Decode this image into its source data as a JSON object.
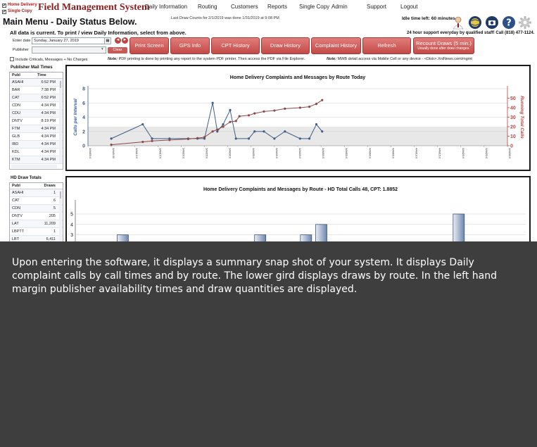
{
  "app": {
    "modes": [
      {
        "label": "Home Delivery",
        "checked": true
      },
      {
        "label": "Single Copy",
        "checked": true
      }
    ],
    "brand": "Field Management System",
    "menu": [
      "Daily Information",
      "Routing",
      "Customers",
      "Reports",
      "Single Copy",
      "Admin",
      "Support",
      "Logout"
    ],
    "draw_counts_note": "Last Draw Counts for 2/1/2019 was done 1/31/2019 at 9:08 PM",
    "idle": "Idle time left: 60 minutes.",
    "support_line": "24 hour support everyday by qualified staff!  Call (818) 477-1124.",
    "header_icons": [
      "support-person-icon",
      "globe-icon",
      "camera-icon",
      "help-icon",
      "settings-gear-icon"
    ]
  },
  "page": {
    "title": "Main  Menu  - Daily Status Below.",
    "current": "All data is current.  To print / view Daily Information, select from above.",
    "enter_date_label": "Enter date",
    "enter_date_value": "Sunday, January 27, 2019",
    "publisher_label": "Publisher",
    "publisher_value": "",
    "clear_label": "Clear",
    "prev_glyph": "◄",
    "next_glyph": "►",
    "buttons": [
      "Print Screen",
      "GPS Info",
      "CPT History",
      "Draw History",
      "Complaint History",
      "Refresh"
    ],
    "recount": {
      "label": "Recount Draws (5 min.)",
      "sub": "Usually done after draw changes."
    },
    "include_label": "Include Criticals, Messages + No Charges",
    "note1_key": "Note:",
    "note1": "PDF printing is done by printing any report to the system PDF printer.  Then access the PDF via File Explorer.",
    "note2_key": "Note:",
    "note2": "MWB detail access via Mobile Cell or any device - <Distr>.XniNews.com/mgmt"
  },
  "mail_times": {
    "title": "Publisher Mail Times",
    "headers": [
      "Publ",
      "Time"
    ],
    "rows": [
      [
        "ASAHI",
        "6:52 PM"
      ],
      [
        "BAR",
        "7:38 PM"
      ],
      [
        "CAT",
        "6:52 PM"
      ],
      [
        "CDN",
        "4:34 PM"
      ],
      [
        "CDU",
        "4:34 PM"
      ],
      [
        "DNTV",
        "8:19 PM"
      ],
      [
        "FTM",
        "4:34 PM"
      ],
      [
        "GLB",
        "4:34 PM"
      ],
      [
        "IBD",
        "4:34 PM"
      ],
      [
        "KDL",
        "4:34 PM"
      ],
      [
        "KTM",
        "4:34 PM"
      ]
    ]
  },
  "draw_totals": {
    "title": "HD Draw Totals",
    "headers": [
      "Publ",
      "Draws"
    ],
    "rows": [
      [
        "ASAHI",
        "1"
      ],
      [
        "CAT",
        "6"
      ],
      [
        "CDN",
        "5"
      ],
      [
        "DNTV",
        "205"
      ],
      [
        "LAT",
        "11,209"
      ],
      [
        "LBPTT",
        "1"
      ],
      [
        "LBT",
        "6,411"
      ]
    ]
  },
  "chart_data": [
    {
      "type": "line",
      "title": "Home Delivery Complaints and Messages by Route Today",
      "ylabel": "Calls per Interval",
      "y2label": "Running Total Calls",
      "ylim": [
        0,
        8
      ],
      "y2lim": [
        0,
        60
      ],
      "yticks": [
        0,
        2,
        4,
        6,
        8
      ],
      "y2ticks": [
        0,
        10,
        20,
        30,
        40,
        50
      ],
      "x": [
        "3AM00:0",
        "3AM5:00",
        "3AM10:0",
        "3AM15:0",
        "3AM20:0",
        "3AM25:0",
        "3AM30:0",
        "3AM35:0",
        "3AM40:0",
        "3AM45:0",
        "3AM50:0",
        "3AM55:0",
        "4AM00:0",
        "4AM05:0",
        "4AM10:0",
        "4AM15:0",
        "4AM20:0",
        "4AM25:0",
        "4AM30:0"
      ],
      "series": [
        {
          "axis": "left",
          "color": "#3f5f86",
          "points": [
            [
              1,
              1
            ],
            [
              2.35,
              3
            ],
            [
              2.75,
              1
            ],
            [
              3.5,
              1
            ],
            [
              4.3,
              1
            ],
            [
              4.7,
              1
            ],
            [
              5,
              1
            ],
            [
              5.35,
              6
            ],
            [
              5.55,
              2
            ],
            [
              5.8,
              3
            ],
            [
              6.1,
              5
            ],
            [
              6.35,
              1
            ],
            [
              6.9,
              1
            ],
            [
              7.15,
              2
            ],
            [
              7.55,
              2
            ],
            [
              8,
              1
            ],
            [
              8.45,
              2
            ],
            [
              9.1,
              1
            ],
            [
              9.5,
              1
            ],
            [
              9.8,
              3
            ],
            [
              10.05,
              2
            ]
          ]
        },
        {
          "axis": "right",
          "color": "#8a4a4a",
          "points": [
            [
              1,
              1
            ],
            [
              2.35,
              4
            ],
            [
              2.75,
              5
            ],
            [
              3.5,
              6
            ],
            [
              4.3,
              7
            ],
            [
              4.7,
              8
            ],
            [
              5,
              9
            ],
            [
              5.35,
              15
            ],
            [
              5.55,
              17
            ],
            [
              5.8,
              20
            ],
            [
              6.1,
              25
            ],
            [
              6.35,
              26
            ],
            [
              6.5,
              31
            ],
            [
              6.9,
              32
            ],
            [
              7.15,
              34
            ],
            [
              7.55,
              36
            ],
            [
              8,
              37
            ],
            [
              8.45,
              39
            ],
            [
              9.1,
              40
            ],
            [
              9.5,
              41
            ],
            [
              9.8,
              44
            ],
            [
              10.05,
              48
            ]
          ]
        }
      ]
    },
    {
      "type": "bar",
      "title": "Home Delivery Complaints and Messages by Route - HD Total Calls 48,  CPT: 1.8852",
      "ylim": [
        0,
        5
      ],
      "yticks": [
        2,
        3,
        4,
        5
      ],
      "bars": [
        {
          "slot": 2,
          "value": 3
        },
        {
          "slot": 9,
          "value": 2
        },
        {
          "slot": 11,
          "value": 3
        },
        {
          "slot": 14,
          "value": 3
        },
        {
          "slot": 15,
          "value": 4
        },
        {
          "slot": 17,
          "value": 2
        },
        {
          "slot": 24,
          "value": 5
        },
        {
          "slot": 25,
          "value": 2
        },
        {
          "slot": 26,
          "value": 2
        },
        {
          "slot": 28,
          "value": 2
        }
      ]
    }
  ],
  "overlay": {
    "text": "Upon entering the software, it displays a summary snap shot of your system.  It displays Daily complaint calls by call times and by route.  The lower gird displays draws by route.  In the left hand margin publisher availability times and draw quantities are displayed."
  }
}
